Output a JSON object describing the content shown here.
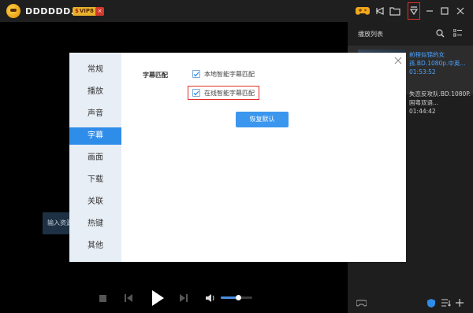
{
  "app": {
    "title": "DDDDDD...",
    "vip_label": "VIP8",
    "vip_prefix": "$",
    "vip_close": "×"
  },
  "titlebar_icons": [
    "gamepad-icon",
    "share-icon",
    "folder-icon",
    "download-icon",
    "minimize-icon",
    "maximize-icon",
    "close-icon"
  ],
  "player": {
    "input_resource_label": "输入资源",
    "volume_level": 0.55
  },
  "playlist": {
    "title": "播放列表",
    "items": [
      {
        "title": "前程似锦的女孩.BD.1080p.中英...",
        "duration": "01:53:52",
        "active": true
      },
      {
        "title": "失恋反攻队.BD.1080P.国粤双语...",
        "duration": "01:44:42",
        "active": false
      }
    ]
  },
  "dialog": {
    "nav": [
      "常规",
      "播放",
      "声音",
      "字幕",
      "画面",
      "下载",
      "关联",
      "热键",
      "其他"
    ],
    "active_nav": "字幕",
    "section_label": "字幕匹配",
    "options": [
      {
        "label": "本地智能字幕匹配",
        "checked": true
      },
      {
        "label": "在线智能字幕匹配",
        "checked": true
      }
    ],
    "restore_button": "恢复默认"
  },
  "colors": {
    "accent": "#2f8dea",
    "highlight": "#e0302a",
    "titlebar": "#1f1f1f",
    "panel": "#1e1e1e"
  }
}
